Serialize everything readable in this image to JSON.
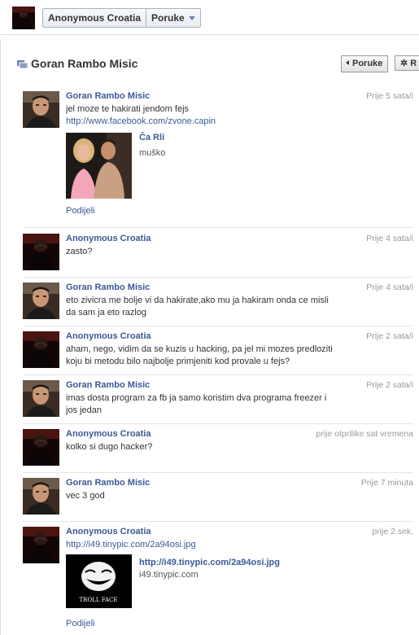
{
  "topbar": {
    "account_name": "Anonymous Croatia",
    "section": "Poruke"
  },
  "conversation": {
    "title": "Goran Rambo Misic",
    "back_button": "Poruke",
    "action_button": "R"
  },
  "messages": [
    {
      "author": "Goran Rambo Misic",
      "time": "Prije 5 sata/i",
      "text_prefix": "jel moze te hakirati jendom fejs ",
      "link": "http://www.facebook.com/zvone.capin",
      "attachment": {
        "title": "Ča Rli",
        "subtitle": "muško"
      },
      "share": "Podijeli"
    },
    {
      "author": "Anonymous Croatia",
      "time": "Prije 4 sata/i",
      "text": "zasto?"
    },
    {
      "author": "Goran Rambo Misic",
      "time": "Prije 4 sata/i",
      "text": "eto zivicra me bolje vi da hakirate,ako mu ja hakiram onda ce misli da sam ja eto razlog"
    },
    {
      "author": "Anonymous Croatia",
      "time": "Prije 2 sata/i",
      "text": "aham, nego, vidim da se kuzis u hacking, pa jel mi mozes predloziti koju bi metodu bilo najbolje primjeniti kod provale u fejs?"
    },
    {
      "author": "Goran Rambo Misic",
      "time": "Prije 2 sata/i",
      "text": "imas dosta program za fb ja samo koristim dva programa freezer i jos jedan"
    },
    {
      "author": "Anonymous Croatia",
      "time": "prije otprilike sat vremena",
      "text": "kolko si dugo hacker?"
    },
    {
      "author": "Goran Rambo Misic",
      "time": "Prije 7 minuta",
      "text": "vec 3 god"
    },
    {
      "author": "Anonymous Croatia",
      "time": "prije 2 sek.",
      "link": "http://i49.tinypic.com/2a94osi.jpg",
      "attachment": {
        "title": "http://i49.tinypic.com/2a94osi.jpg",
        "subtitle": "i49.tinypic.com",
        "image_caption": "TROLL FACE"
      },
      "share": "Podijeli"
    }
  ]
}
